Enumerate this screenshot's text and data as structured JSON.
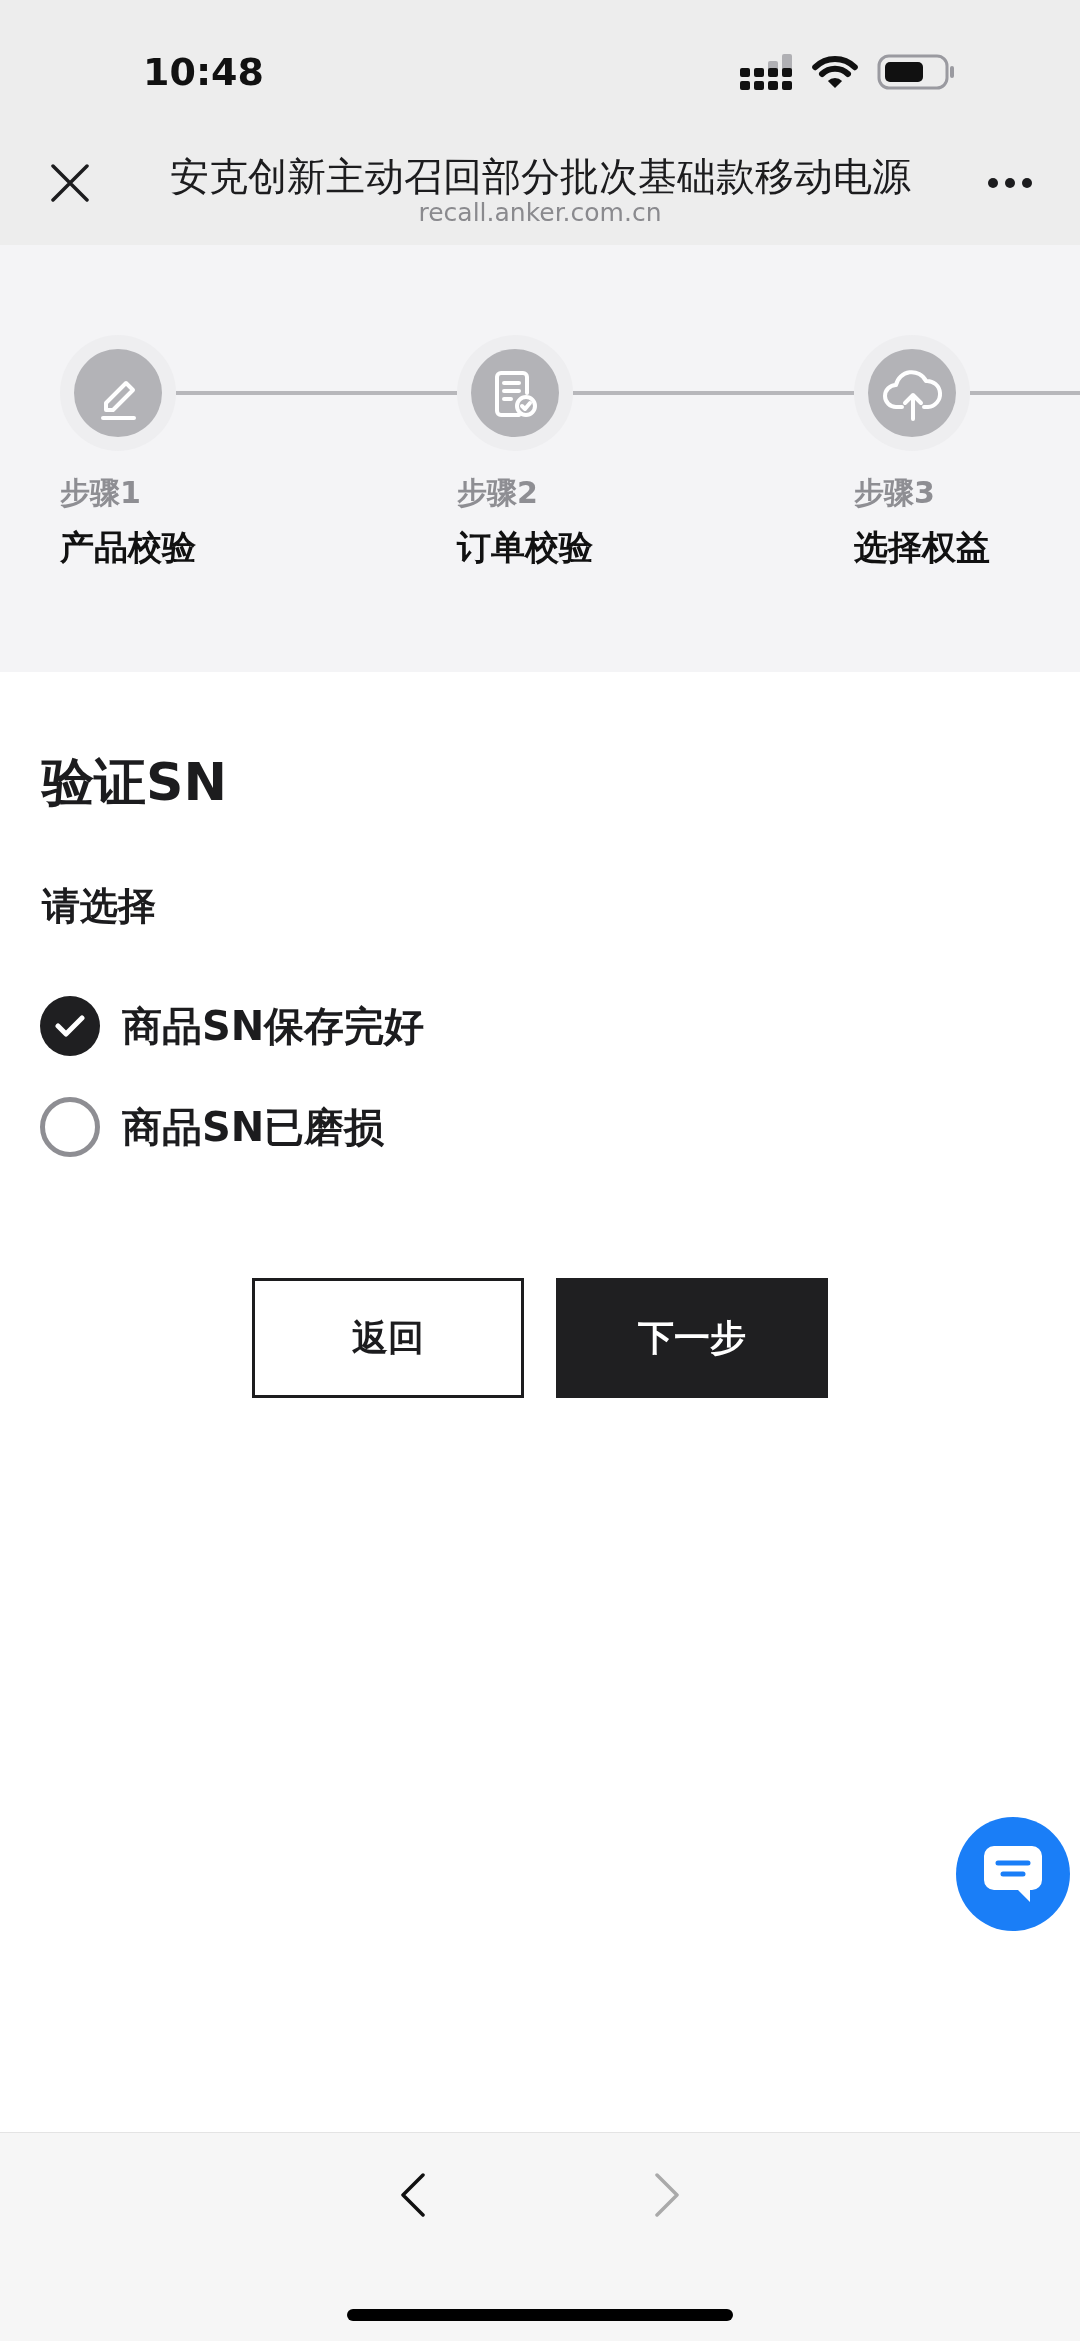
{
  "status_bar": {
    "time": "10:48"
  },
  "nav_bar": {
    "title": "安克创新主动召回部分批次基础款移动电源",
    "url": "recall.anker.com.cn"
  },
  "steps": [
    {
      "label": "步骤1",
      "title": "产品校验"
    },
    {
      "label": "步骤2",
      "title": "订单校验"
    },
    {
      "label": "步骤3",
      "title": "选择权益"
    }
  ],
  "form": {
    "title": "验证SN",
    "prompt": "请选择",
    "options": [
      {
        "label": "商品SN保存完好",
        "selected": true
      },
      {
        "label": "商品SN已磨损",
        "selected": false
      }
    ],
    "buttons": [
      {
        "label": "返回",
        "kind": "secondary"
      },
      {
        "label": "下一步",
        "kind": "primary"
      }
    ]
  },
  "browser_toolbar": {
    "back": {
      "disabled": false
    },
    "forward": {
      "disabled": true
    }
  }
}
